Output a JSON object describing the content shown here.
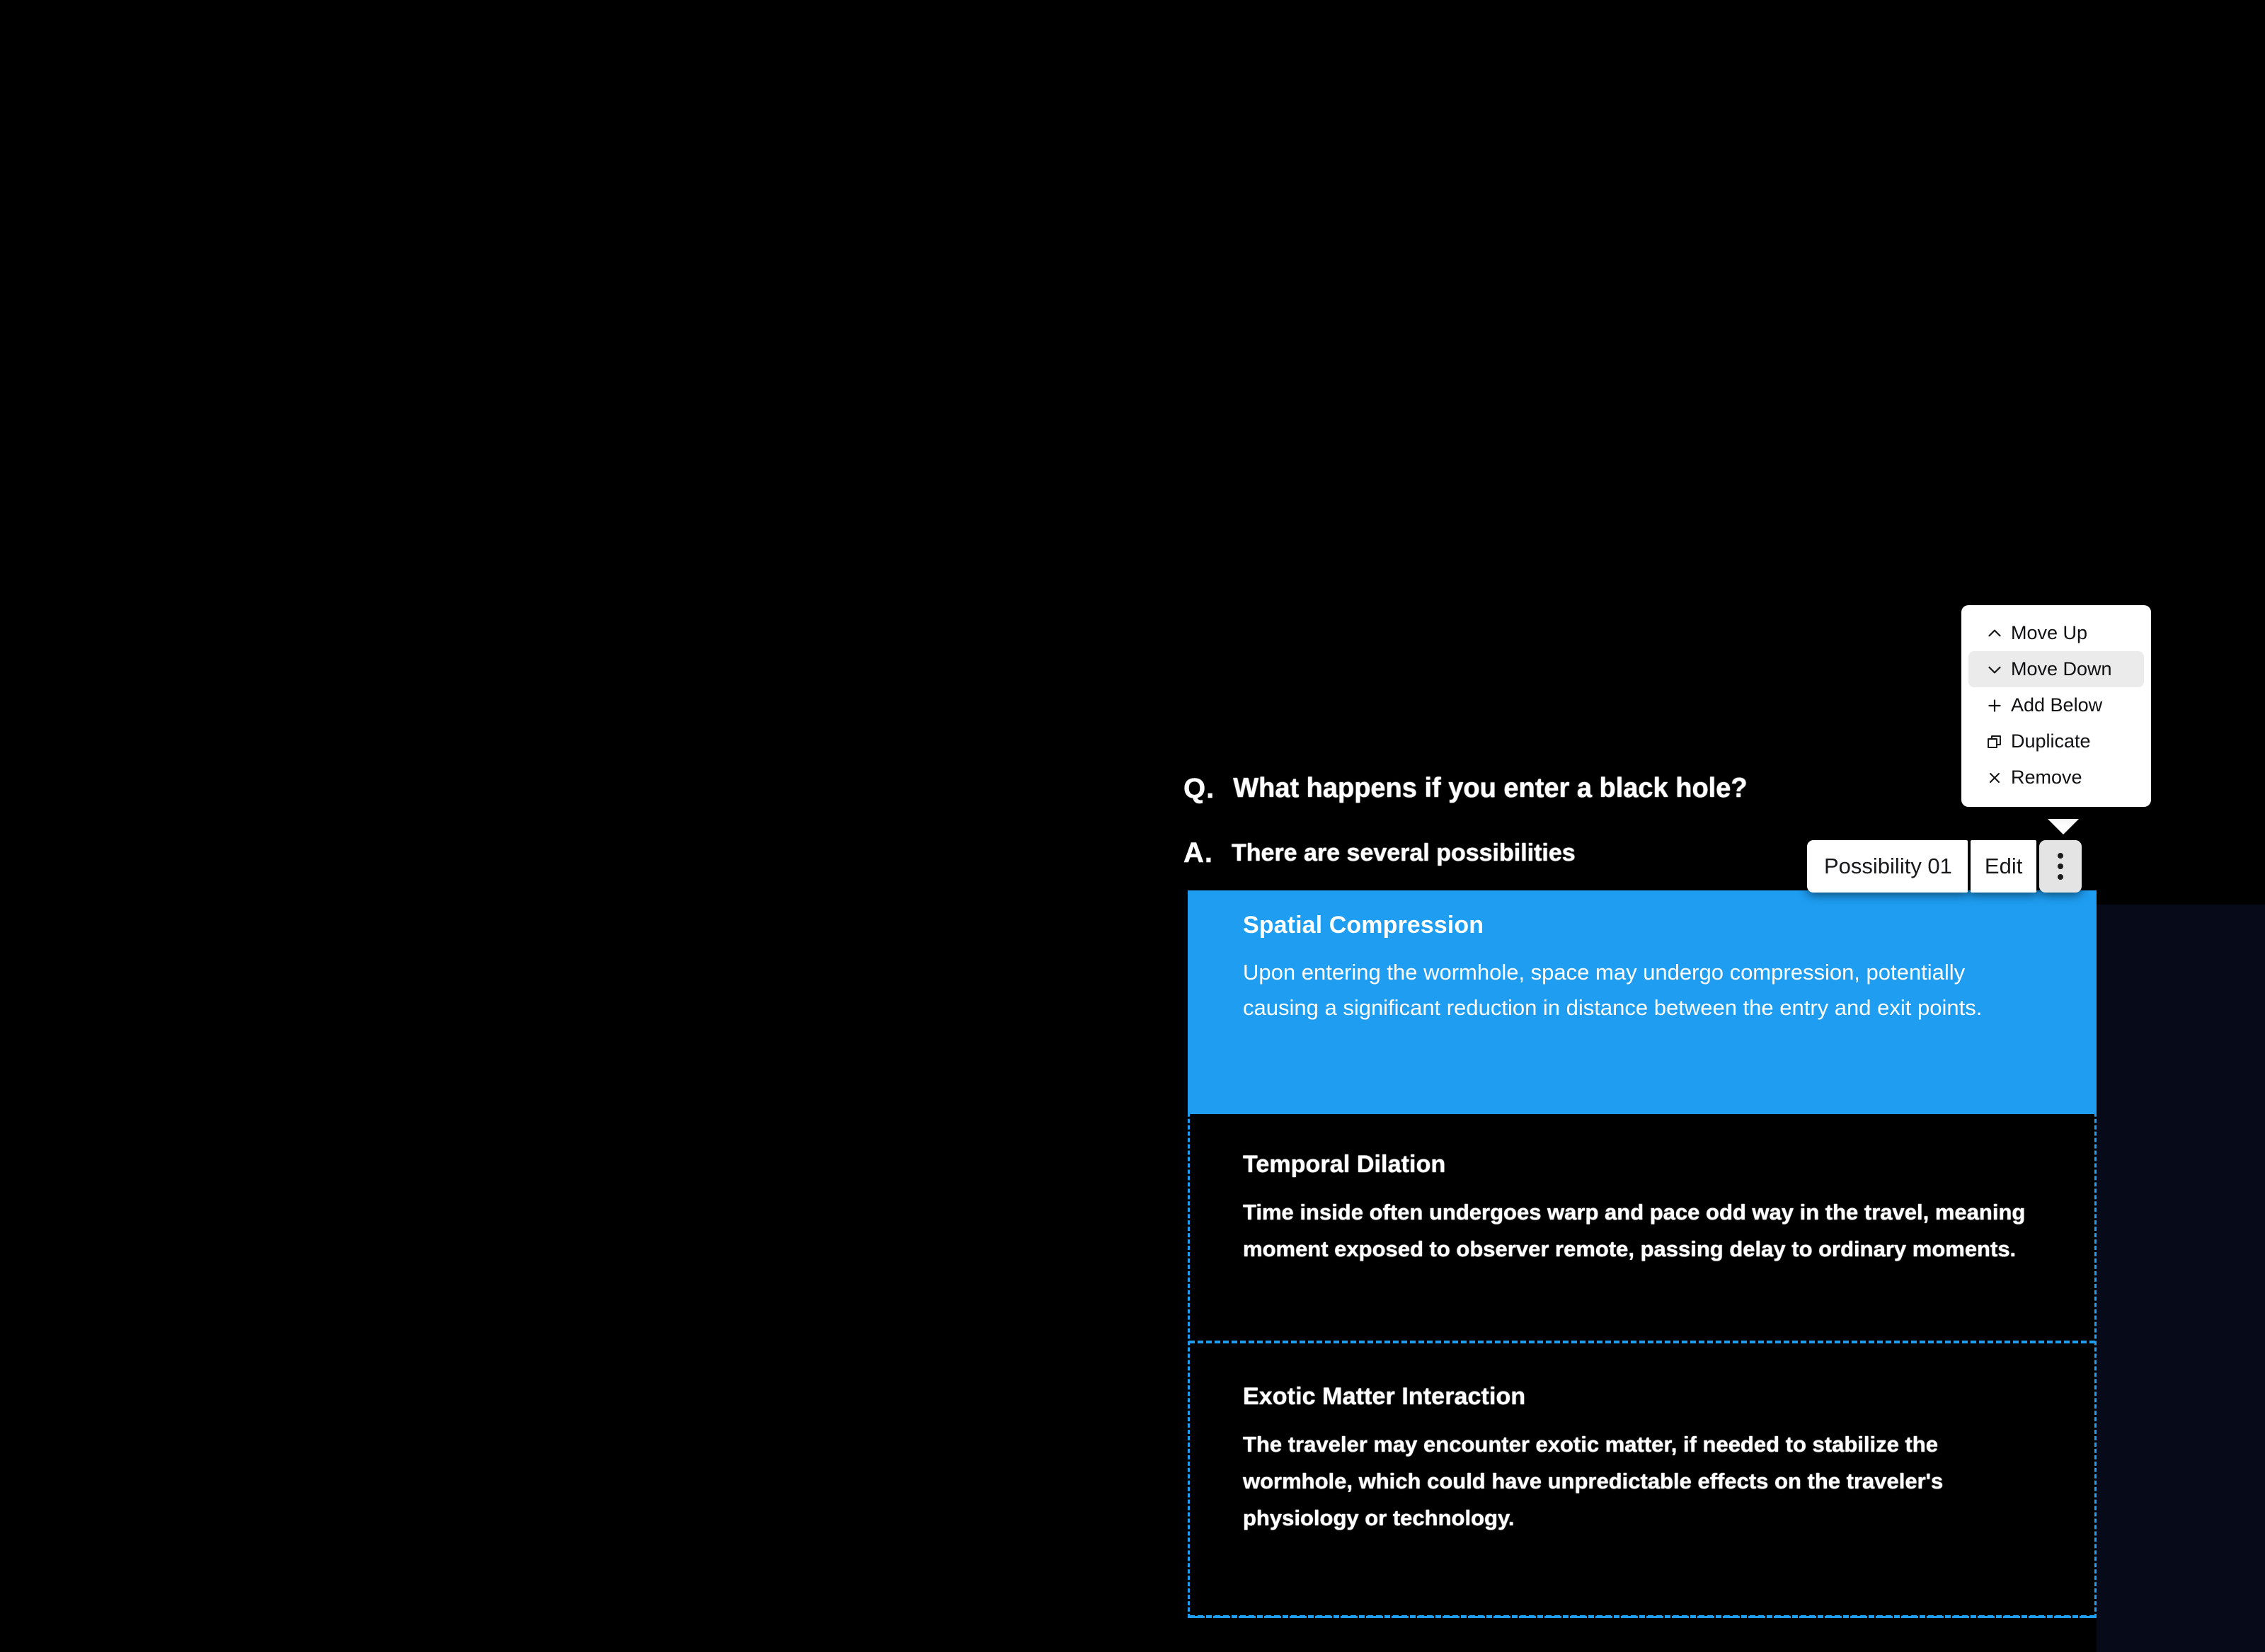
{
  "question": {
    "marker": "Q.",
    "text": "What happens if you enter a black hole?"
  },
  "answer": {
    "marker": "A.",
    "text": "There are several possibilities"
  },
  "toolbar": {
    "possibility_label": "Possibility 01",
    "edit_label": "Edit",
    "kebab_icon": "more-vertical-icon"
  },
  "context_menu": {
    "items": [
      {
        "label": "Move Up",
        "icon": "chevron-up-icon",
        "selected": false
      },
      {
        "label": "Move Down",
        "icon": "chevron-down-icon",
        "selected": true
      },
      {
        "label": "Add Below",
        "icon": "plus-icon",
        "selected": false
      },
      {
        "label": "Duplicate",
        "icon": "copy-icon",
        "selected": false
      },
      {
        "label": "Remove",
        "icon": "close-x-icon",
        "selected": false
      }
    ]
  },
  "possibilities": [
    {
      "title": "Spatial Compression",
      "body": "Upon entering the wormhole, space may undergo compression, potentially causing a significant reduction in distance between the entry and exit points.",
      "state": "active"
    },
    {
      "title": "Temporal Dilation",
      "body": "Time inside often undergoes warp and pace odd way in the travel, meaning moment exposed to observer remote, passing delay to ordinary moments.",
      "state": "inactive"
    },
    {
      "title": "Exotic Matter Interaction",
      "body": "The traveler may encounter exotic matter, if needed to stabilize the wormhole, which could have unpredictable effects on the traveler's physiology or technology.",
      "state": "inactive"
    }
  ],
  "colors": {
    "accent": "#1e9df1",
    "panel_dark": "#070a18",
    "menu_bg": "#ffffff",
    "menu_selected": "#ebebeb",
    "kebab_bg": "#e4e4e4"
  }
}
